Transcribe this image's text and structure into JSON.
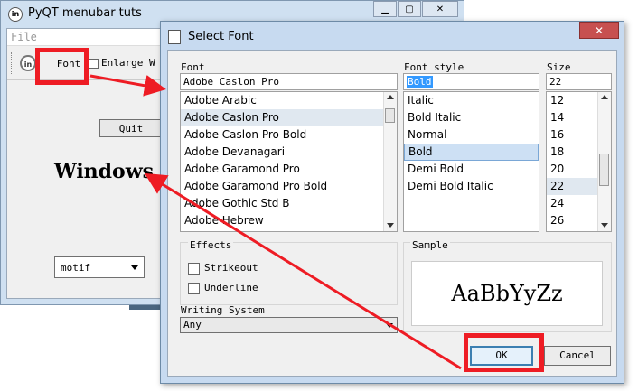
{
  "main_window": {
    "title": "PyQT menubar tuts",
    "logo_text": "in",
    "menu_file": "File",
    "toolbar": {
      "icon_text": "in",
      "font_action": "Font",
      "enlarge_label": "Enlarge W"
    },
    "quit_label": "Quit",
    "style_text": "Windows",
    "style_combo_value": "motif",
    "buttons": {
      "minimize": "▁",
      "maximize": "▢",
      "close": "✕"
    }
  },
  "font_dialog": {
    "title": "Select Font",
    "close_label": "✕",
    "font_label": "Font",
    "font_value": "Adobe Caslon Pro",
    "font_items": [
      "Adobe Arabic",
      "Adobe Caslon Pro",
      "Adobe Caslon Pro Bold",
      "Adobe Devanagari",
      "Adobe Garamond Pro",
      "Adobe Garamond Pro Bold",
      "Adobe Gothic Std B",
      "Adobe Hebrew"
    ],
    "font_selected_index": 1,
    "style_label": "Font style",
    "style_value": "Bold",
    "style_items": [
      "Italic",
      "Bold Italic",
      "Normal",
      "Bold",
      "Demi Bold",
      "Demi Bold Italic"
    ],
    "style_selected_index": 3,
    "size_label": "Size",
    "size_value": "22",
    "size_items": [
      "12",
      "14",
      "16",
      "18",
      "20",
      "22",
      "24",
      "26"
    ],
    "size_selected_index": 5,
    "effects_label": "Effects",
    "strikeout_label": "Strikeout",
    "underline_label": "Underline",
    "writing_system_label": "Writing System",
    "writing_system_value": "Any",
    "sample_label": "Sample",
    "sample_text": "AaBbYyZz",
    "ok_label": "OK",
    "cancel_label": "Cancel"
  },
  "colors": {
    "annotation_red": "#ee1c24",
    "selection_blue": "#3399ff"
  }
}
